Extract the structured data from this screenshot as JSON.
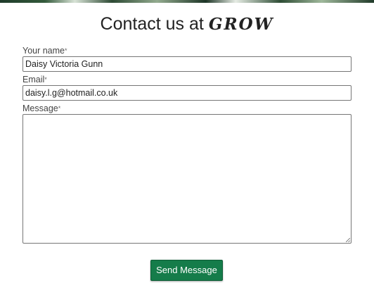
{
  "heading": {
    "prefix": "Contact us at",
    "brand": "GROW"
  },
  "form": {
    "name": {
      "label": "Your name",
      "required_mark": "*",
      "value": "Daisy Victoria Gunn"
    },
    "email": {
      "label": "Email",
      "required_mark": "*",
      "value": "daisy.l.g@hotmail.co.uk"
    },
    "message": {
      "label": "Message",
      "required_mark": "*",
      "value": ""
    },
    "submit_label": "Send Message"
  },
  "colors": {
    "button_bg": "#157c4a",
    "button_text": "#ffffff",
    "input_border": "#767676"
  }
}
